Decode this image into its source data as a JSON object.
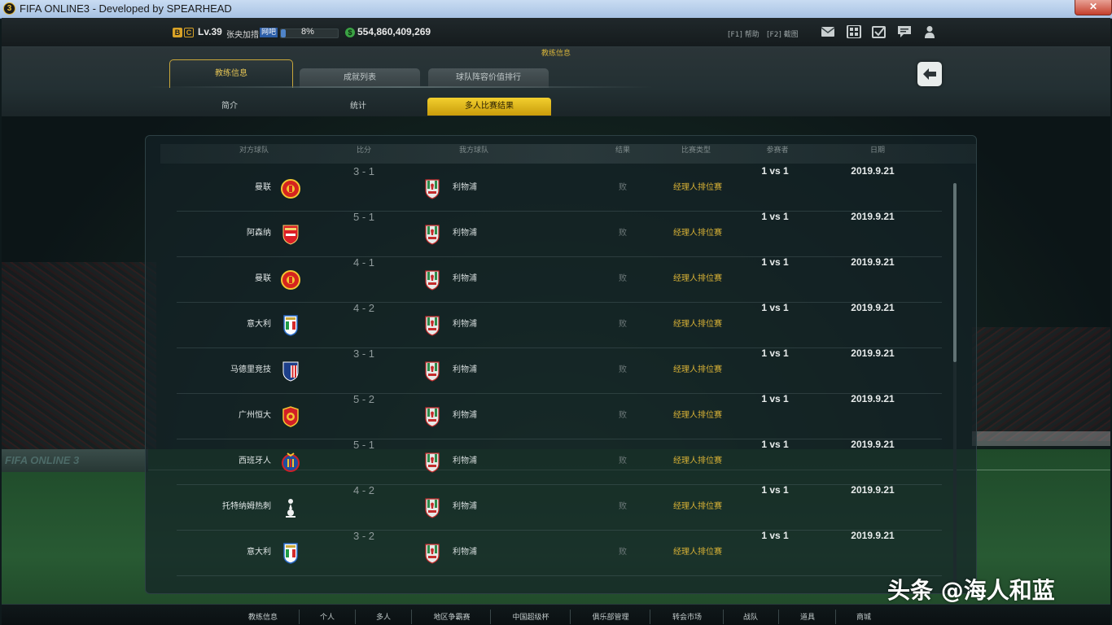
{
  "window": {
    "icon_text": "3",
    "title": "FIFA ONLINE3 - Developed by SPEARHEAD",
    "close_label": "✕"
  },
  "header": {
    "grade_b": "B",
    "grade_c": "C",
    "level": "Lv.39",
    "player_name": "张央加措",
    "net_tag": "网吧",
    "exp_percent": 8,
    "exp_text": "8%",
    "coins": "554,860,409,269",
    "help_label": "[F1] 帮助",
    "screenshot_label": "[F2] 截图",
    "icons": [
      "mail-icon",
      "grid-icon",
      "calendar-check-icon",
      "chat-icon",
      "user-icon"
    ]
  },
  "page": {
    "section_title": "教练信息",
    "tabs": [
      {
        "label": "教练信息",
        "active": true
      },
      {
        "label": "成就列表",
        "active": false
      },
      {
        "label": "球队阵容价值排行",
        "active": false
      }
    ],
    "subtabs": [
      {
        "label": "简介",
        "active": false
      },
      {
        "label": "统计",
        "active": false
      },
      {
        "label": "多人比赛结果",
        "active": true
      }
    ],
    "back_icon": "back-arrow-icon"
  },
  "table": {
    "headers": [
      "对方球队",
      "比分",
      "我方球队",
      "结果",
      "比赛类型",
      "参赛者",
      "日期"
    ],
    "rows": [
      {
        "opponent": "曼联",
        "crest": "man-utd",
        "score": "3 - 1",
        "my_team": "利物浦",
        "result": "败",
        "match_type": "经理人排位赛",
        "players": "1 vs 1",
        "date": "2019.9.21"
      },
      {
        "opponent": "阿森纳",
        "crest": "arsenal",
        "score": "5 - 1",
        "my_team": "利物浦",
        "result": "败",
        "match_type": "经理人排位赛",
        "players": "1 vs 1",
        "date": "2019.9.21"
      },
      {
        "opponent": "曼联",
        "crest": "man-utd",
        "score": "4 - 1",
        "my_team": "利物浦",
        "result": "败",
        "match_type": "经理人排位赛",
        "players": "1 vs 1",
        "date": "2019.9.21"
      },
      {
        "opponent": "意大利",
        "crest": "italy",
        "score": "4 - 2",
        "my_team": "利物浦",
        "result": "败",
        "match_type": "经理人排位赛",
        "players": "1 vs 1",
        "date": "2019.9.21"
      },
      {
        "opponent": "马德里竞技",
        "crest": "atletico",
        "score": "3 - 1",
        "my_team": "利物浦",
        "result": "败",
        "match_type": "经理人排位赛",
        "players": "1 vs 1",
        "date": "2019.9.21"
      },
      {
        "opponent": "广州恒大",
        "crest": "guangzhou",
        "score": "5 - 2",
        "my_team": "利物浦",
        "result": "败",
        "match_type": "经理人排位赛",
        "players": "1 vs 1",
        "date": "2019.9.21"
      },
      {
        "opponent": "西班牙人",
        "crest": "espanyol",
        "score": "5 - 1",
        "my_team": "利物浦",
        "result": "败",
        "match_type": "经理人排位赛",
        "players": "1 vs 1",
        "date": "2019.9.21"
      },
      {
        "opponent": "托特纳姆热刺",
        "crest": "tottenham",
        "score": "4 - 2",
        "my_team": "利物浦",
        "result": "败",
        "match_type": "经理人排位赛",
        "players": "1 vs 1",
        "date": "2019.9.21"
      },
      {
        "opponent": "意大利",
        "crest": "italy",
        "score": "3 - 2",
        "my_team": "利物浦",
        "result": "败",
        "match_type": "经理人排位赛",
        "players": "1 vs 1",
        "date": "2019.9.21"
      }
    ]
  },
  "bottom_nav": [
    {
      "label": "教练信息",
      "active": true
    },
    {
      "label": "个人",
      "active": false
    },
    {
      "label": "多人",
      "active": false
    },
    {
      "label": "地区争霸赛",
      "active": false
    },
    {
      "label": "中国超级杯",
      "active": false
    },
    {
      "label": "俱乐部管理",
      "active": false
    },
    {
      "label": "转会市场",
      "active": false
    },
    {
      "label": "战队",
      "active": false
    },
    {
      "label": "道具",
      "active": false
    },
    {
      "label": "商城",
      "active": false
    }
  ],
  "background": {
    "ad_text": "FIFA ONLINE 3"
  },
  "watermark": "头条 @海人和蓝",
  "colors": {
    "accent_gold": "#d9b236",
    "active_subtab": "#f2cf2e",
    "panel_bg": "#142226",
    "exp_blue": "#4f84c9",
    "coin_green": "#3ba244"
  }
}
